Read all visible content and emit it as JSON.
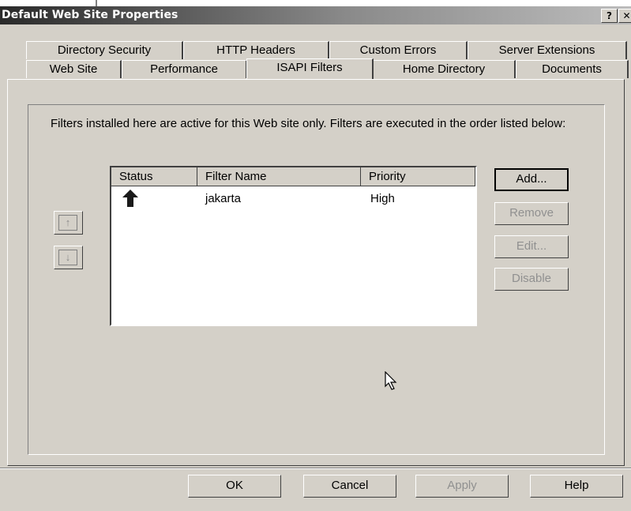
{
  "window": {
    "title": "Default Web Site Properties",
    "help_button": "?",
    "close_button": "✕"
  },
  "tabs": {
    "row1": [
      "Directory Security",
      "HTTP Headers",
      "Custom Errors",
      "Server Extensions"
    ],
    "row2": [
      "Web Site",
      "Performance",
      "ISAPI Filters",
      "Home Directory",
      "Documents"
    ],
    "active": "ISAPI Filters"
  },
  "panel": {
    "description": "Filters installed here are active for this Web site only. Filters are executed in the order listed below:"
  },
  "filter_table": {
    "columns": [
      "Status",
      "Filter Name",
      "Priority"
    ],
    "rows": [
      {
        "status_icon": "up-arrow-icon",
        "name": "jakarta",
        "priority": "High"
      }
    ]
  },
  "side_buttons": {
    "add": "Add...",
    "remove": "Remove",
    "edit": "Edit...",
    "disable": "Disable"
  },
  "order_buttons": {
    "up_icon": "move-up-icon",
    "down_icon": "move-down-icon"
  },
  "footer": {
    "ok": "OK",
    "cancel": "Cancel",
    "apply": "Apply",
    "help": "Help"
  }
}
